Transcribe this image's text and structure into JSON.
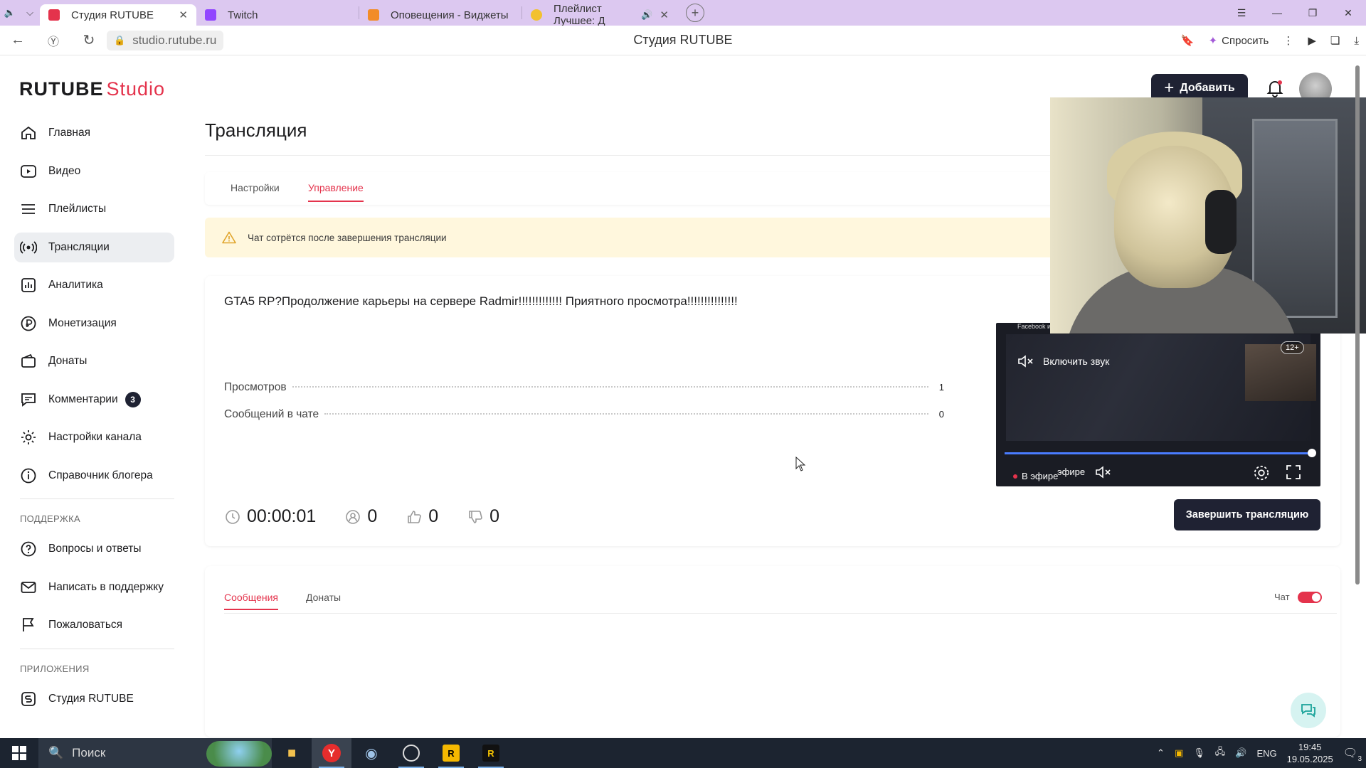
{
  "browser": {
    "tabs": [
      {
        "label": "Студия RUTUBE",
        "active": true,
        "favicon_color": "#e4334c",
        "closable": true
      },
      {
        "label": "Twitch",
        "active": false,
        "favicon_color": "#9146ff",
        "closable": false
      },
      {
        "label": "Оповещения - Виджеты",
        "active": false,
        "favicon_color": "#f28c28",
        "closable": false
      },
      {
        "label": "Плейлист Лучшее: Д",
        "active": false,
        "favicon_color": "#f2c12e",
        "closable": true
      }
    ],
    "url": "studio.rutube.ru",
    "page_title": "Студия RUTUBE",
    "ask_label": "Спросить"
  },
  "header": {
    "logo_main": "RUTUBE",
    "logo_accent": "Studio",
    "add_label": "Добавить"
  },
  "sidebar": {
    "items": [
      {
        "label": "Главная",
        "icon": "home-icon"
      },
      {
        "label": "Видео",
        "icon": "video-icon"
      },
      {
        "label": "Плейлисты",
        "icon": "playlist-icon"
      },
      {
        "label": "Трансляции",
        "icon": "broadcast-icon",
        "active": true
      },
      {
        "label": "Аналитика",
        "icon": "analytics-icon"
      },
      {
        "label": "Монетизация",
        "icon": "ruble-icon"
      },
      {
        "label": "Донаты",
        "icon": "wallet-icon"
      },
      {
        "label": "Комментарии",
        "icon": "comment-icon",
        "badge": "3"
      },
      {
        "label": "Настройки канала",
        "icon": "gear-icon"
      },
      {
        "label": "Справочник блогера",
        "icon": "info-icon"
      }
    ],
    "support_title": "ПОДДЕРЖКА",
    "support_items": [
      {
        "label": "Вопросы и ответы",
        "icon": "question-icon"
      },
      {
        "label": "Написать в поддержку",
        "icon": "mail-icon"
      },
      {
        "label": "Пожаловаться",
        "icon": "flag-icon"
      }
    ],
    "apps_title": "ПРИЛОЖЕНИЯ",
    "apps_items": [
      {
        "label": "Студия RUTUBE",
        "icon": "studio-icon"
      }
    ]
  },
  "main": {
    "title": "Трансляция",
    "tabs": [
      "Настройки",
      "Управление"
    ],
    "active_tab": "Управление",
    "warning": "Чат сотрётся после завершения трансляции",
    "stream": {
      "title": "GTA5 RP?Продолжение карьеры на сервере Radmir!!!!!!!!!!!!! Приятного просмотра!!!!!!!!!!!!!!!",
      "views_label": "Просмотров",
      "views_value": "1",
      "messages_label": "Сообщений в чате",
      "messages_value": "0",
      "duration": "00:00:01",
      "viewers": "0",
      "likes": "0",
      "dislikes": "0",
      "end_label": "Завершить трансляцию"
    },
    "player": {
      "notice": "Facebook и Instagram запрещены в РФ",
      "age": "12+",
      "unmute_label": "Включить звук",
      "live_label": "В эфире",
      "live_label_2": "эфире",
      "progress": 0.99
    },
    "chat": {
      "tabs": [
        "Сообщения",
        "Донаты"
      ],
      "active_tab": "Сообщения",
      "toggle_label": "Чат",
      "toggle_on": true
    }
  },
  "taskbar": {
    "search_label": "Поиск",
    "lang": "ENG",
    "time": "19:45",
    "date": "19.05.2025",
    "notifications": "3"
  },
  "colors": {
    "accent": "#e4334c",
    "dark_button": "#1f2233",
    "warning_bg": "#fff7dd"
  }
}
